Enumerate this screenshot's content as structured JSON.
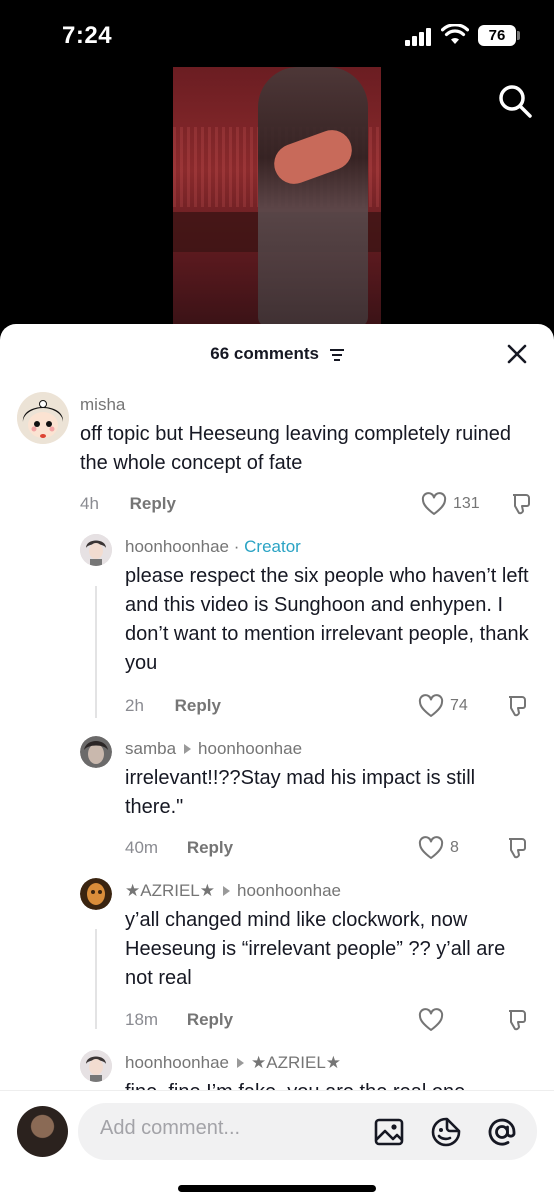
{
  "status_bar": {
    "time": "7:24",
    "battery": "76"
  },
  "sheet": {
    "comments_count": "66 comments"
  },
  "comments": [
    {
      "username": "misha",
      "text": "off topic but Heeseung leaving completely ruined the whole concept of fate",
      "time": "4h",
      "reply_label": "Reply",
      "likes": "131"
    },
    {
      "username": "hoonhoonhae",
      "separator": " · ",
      "badge": "Creator",
      "text": "please respect the six people who haven’t left and this video is Sunghoon and enhypen. I don’t want to mention irrelevant people, thank you",
      "time": "2h",
      "reply_label": "Reply",
      "likes": "74"
    },
    {
      "username": "samba",
      "reply_to": "hoonhoonhae",
      "text": "irrelevant!!??Stay mad his impact is still there.\"",
      "time": "40m",
      "reply_label": "Reply",
      "likes": "8"
    },
    {
      "username": "★AZRIEL★",
      "reply_to": "hoonhoonhae",
      "text": "y’all changed mind like clockwork, now Heeseung is “irrelevant people” ?? y’all are not real",
      "time": "18m",
      "reply_label": "Reply",
      "likes": ""
    },
    {
      "username": "hoonhoonhae",
      "reply_to": "★AZRIEL★",
      "text": "fine, fine I’m fake, you are the real one"
    }
  ],
  "composer": {
    "placeholder": "Add comment..."
  },
  "icons": {
    "search": "search-icon",
    "close": "close-icon",
    "filter": "filter-icon",
    "heart": "heart-icon",
    "dislike": "dislike-icon",
    "image": "image-icon",
    "emoji": "emoji-icon",
    "mention": "mention-icon"
  },
  "colors": {
    "creator_badge": "#2aa3c4",
    "text": "#161823",
    "muted": "#757575",
    "input_bg": "#f1f1f2"
  }
}
